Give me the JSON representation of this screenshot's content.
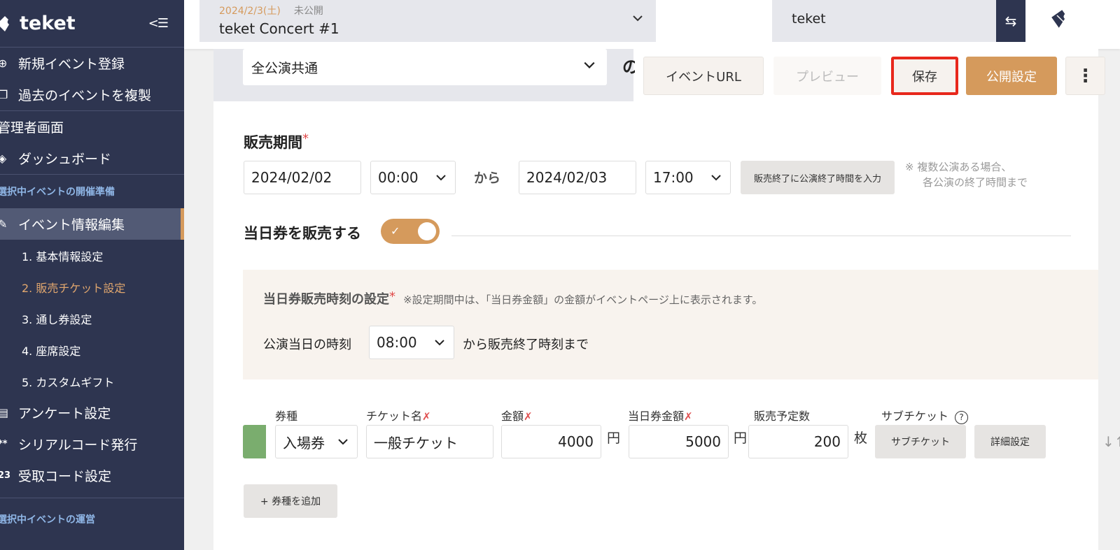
{
  "sidebar": {
    "logo_text": "teket",
    "collapse_glyph": "<☰",
    "items_top": [
      {
        "label": "新規イベント登録",
        "icon": "plus-circle-icon"
      },
      {
        "label": "過去のイベントを複製",
        "icon": "copy-icon"
      }
    ],
    "admin_label": "管理者画面",
    "dashboard_label": "ダッシュボード",
    "section_prep": "選択中イベントの開催準備",
    "edit_label": "イベント情報編集",
    "sub_items": [
      "1. 基本情報設定",
      "2. 販売チケット設定",
      "3. 通し券設定",
      "4. 座席設定",
      "5. カスタムギフト"
    ],
    "items_more": [
      {
        "label": "アンケート設定",
        "icon": "survey-icon",
        "glyph": "▤"
      },
      {
        "label": "シリアルコード発行",
        "icon": "serial-icon",
        "glyph": "**"
      },
      {
        "label": "受取コード設定",
        "icon": "code-icon",
        "glyph": "23"
      }
    ],
    "section_ops": "選択中イベントの運営"
  },
  "topbar": {
    "event_date": "2024/2/3(土)",
    "event_status": "未公開",
    "event_name": "teket Concert #1",
    "org_name": "teket",
    "swap_glyph": "⇆"
  },
  "main": {
    "performance_select": "全公演共通",
    "no_char": "の",
    "actions": {
      "event_url": "イベントURL",
      "preview": "プレビュー",
      "save": "保存",
      "publish": "公開設定",
      "more": "⋮"
    },
    "sales_period": {
      "label": "販売期間",
      "req": "*",
      "start_date": "2024/02/02",
      "start_time": "00:00",
      "from": "から",
      "end_date": "2024/02/03",
      "end_time": "17:00",
      "fill_button": "販売終了に公演終了時間を入力",
      "note_line1": "※ 複数公演ある場合、",
      "note_line2": "各公演の終了時間まで"
    },
    "day_ticket": {
      "toggle_label": "当日券を販売する",
      "toggle_on": true,
      "time_label": "当日券販売時刻の設定",
      "req": "*",
      "time_note": "※設定期間中は、「当日券金額」の金額がイベントページ上に表示されます。",
      "day_time_label": "公演当日の時刻",
      "day_time_value": "08:00",
      "until_label": "から販売終了時刻まで"
    },
    "ticket_table": {
      "headers": {
        "type": "券種",
        "name": "チケット名",
        "price": "金額",
        "day_price": "当日券金額",
        "quantity": "販売予定数",
        "sub": "サブチケット",
        "help": "?"
      },
      "row": {
        "type": "入場券",
        "name": "一般チケット",
        "price": "4000",
        "price_unit": "円",
        "day_price": "5000",
        "day_price_unit": "円",
        "quantity": "200",
        "quantity_unit": "枚",
        "sub_button": "サブチケット",
        "detail_button": "詳細設定",
        "sort_glyph": "↓↑"
      },
      "add_button": "+ 券種を追加"
    }
  }
}
